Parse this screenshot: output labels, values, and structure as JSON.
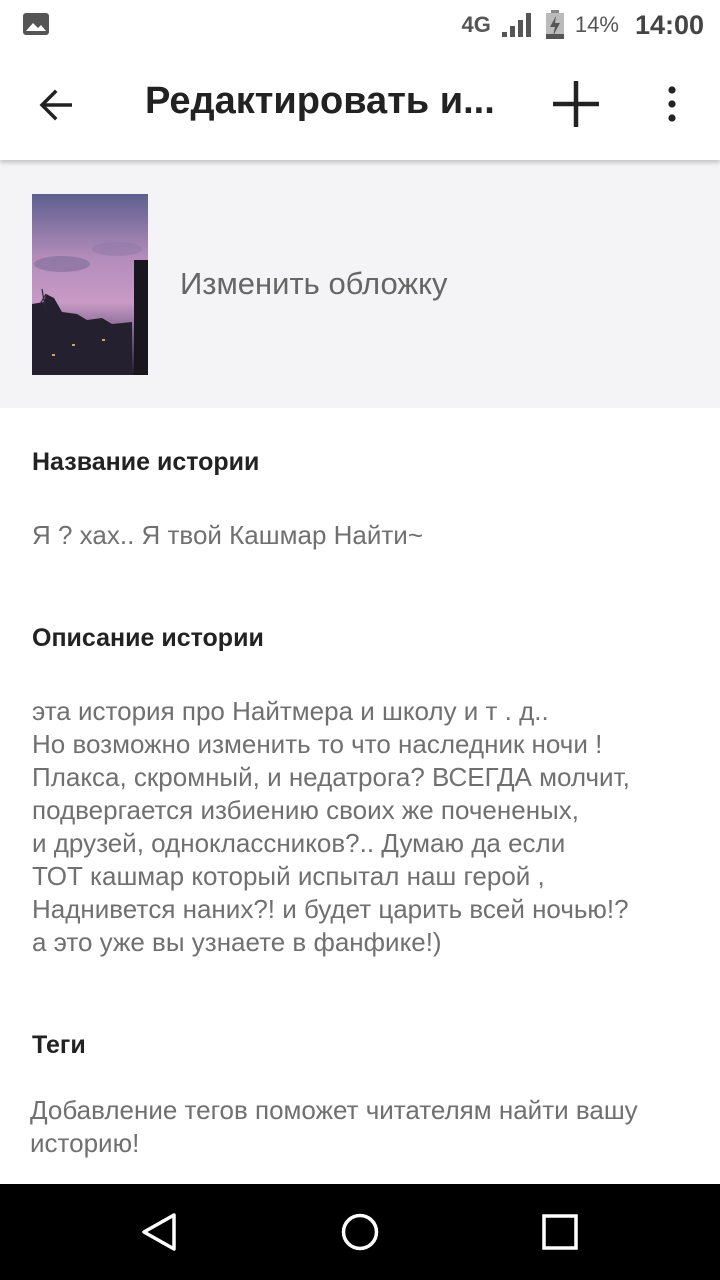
{
  "status_bar": {
    "network": "4G",
    "battery_percent": "14%",
    "time": "14:00"
  },
  "app_bar": {
    "title": "Редактировать и...",
    "icons": [
      "back-arrow-icon",
      "plus-icon",
      "more-vert-icon"
    ]
  },
  "cover": {
    "change_cover_label": "Изменить обложку"
  },
  "story": {
    "title_label": "Название истории",
    "title_value": "Я ?  хах.. Я твой Кашмар Найти~",
    "description_label": "Описание истории",
    "description_value": "эта история про Найтмера и школу и т . д..\nНо возможно изменить то что наследник ночи !\nПлакса, скромный, и недатрога? ВСЕГДА молчит,\nподвергается избиению своих же почененых,\nи друзей, одноклассников?.. Думаю да если\nТОТ кашмар который испытал наш герой ,\nНадниветcя наних?! и будет царить всей ночью!?\nа это уже вы узнаете в фанфике!)",
    "tags_label": "Теги",
    "tags_hint": "Добавление тегов поможет читателям найти вашу\nисторию!"
  },
  "nav_bar": {
    "icons": [
      "back-triangle-icon",
      "home-circle-icon",
      "recents-square-icon"
    ]
  },
  "colors": {
    "cover_bg": "#f4f3f5",
    "nav_bg": "#000000",
    "text_secondary": "#707070"
  }
}
